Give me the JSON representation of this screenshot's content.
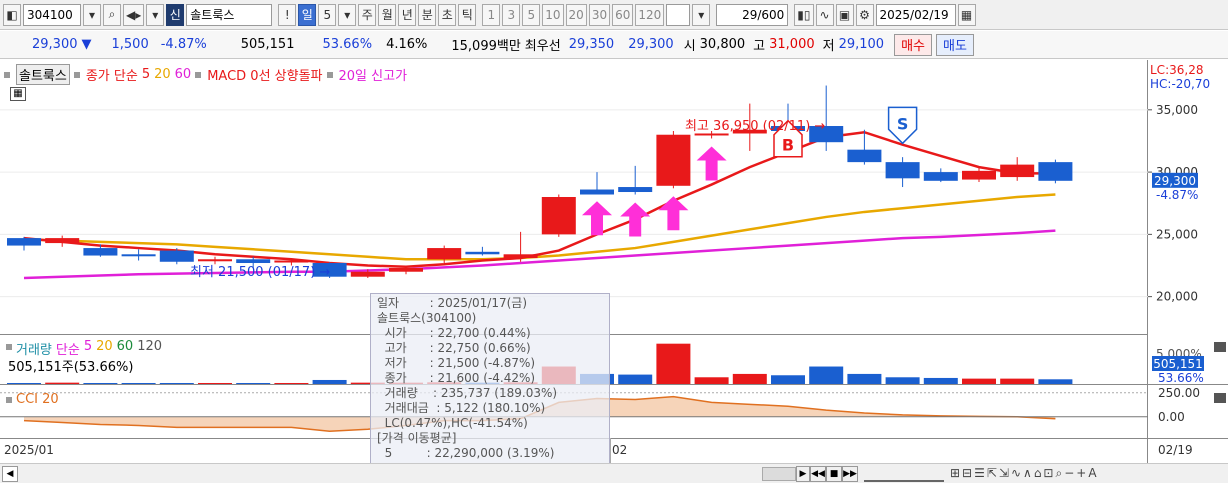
{
  "toolbar": {
    "code": "304100",
    "credit_badge": "신",
    "stock_name": "솔트룩스",
    "exclaim": "!",
    "period_day": "일",
    "period_num": "5",
    "tabs": [
      "주",
      "월",
      "년",
      "분",
      "초",
      "틱"
    ],
    "intervals": [
      "1",
      "3",
      "5",
      "10",
      "20",
      "30",
      "60",
      "120"
    ],
    "count": "29/600",
    "date": "2025/02/19"
  },
  "info": {
    "price": "29,300",
    "arrow": "▼",
    "change": "1,500",
    "change_pct": "-4.87%",
    "volume": "505,151",
    "vol_ratio": "53.66%",
    "turnover": "4.16%",
    "amount": "15,099백만",
    "best_label": "최우선",
    "ask": "29,350",
    "bid": "29,300",
    "open_label": "시",
    "open": "30,800",
    "high_label": "고",
    "high": "31,000",
    "low_label": "저",
    "low": "29,100",
    "buy_label": "매수",
    "sell_label": "매도"
  },
  "legend": {
    "name": "솔트룩스",
    "ma_label": "종가 단순",
    "ma5": "5",
    "ma20": "20",
    "ma60": "60",
    "macd": "MACD 0선 상향돌파",
    "newhigh": "20일 신고가"
  },
  "axis": {
    "lc": "LC:36,28",
    "hc": "HC:-20,70",
    "ticks": [
      "35,000",
      "30,000",
      "25,000",
      "20,000"
    ],
    "cur_price": "29,300",
    "cur_pct": "-4.87%",
    "vol_tick": "5,000%",
    "vol_val": "505,151",
    "vol_pct": "53.66%",
    "cci_ticks": [
      "250.00",
      "0.00"
    ],
    "date_start": "2025/01",
    "date_mid": "02",
    "date_end": "02/19"
  },
  "annotations": {
    "high": "최고 36,950 (02/11)",
    "low": "최저 21,500 (01/17)",
    "buy": "B",
    "sell": "S"
  },
  "volume_panel": {
    "title": "거래량",
    "ma_label": "단순",
    "ma5": "5",
    "ma20": "20",
    "ma60": "60",
    "ma120": "120",
    "summary": "505,151주(53.66%)"
  },
  "cci_panel": {
    "title": "CCI 20"
  },
  "tooltip": [
    "일자        : 2025/01/17(금)",
    "솔트룩스(304100)",
    "  시가      : 22,700 (0.44%)",
    "  고가      : 22,750 (0.66%)",
    "  저가      : 21,500 (-4.87%)",
    "  종가      : 21,600 (-4.42%)",
    "  거래량    : 235,737 (189.03%)",
    "  거래대금  : 5,122 (180.10%)",
    "  LC(0.47%),HC(-41.54%)",
    "[가격 이동평균]",
    "  5         : 22,290,000 (3.19%)"
  ],
  "colors": {
    "up": "#e8191a",
    "down": "#1a5fd0",
    "ma5": "#e8191a",
    "ma20": "#e8a800",
    "ma60": "#e020d8",
    "signal": "#ff2fd8"
  },
  "chart_data": {
    "type": "candlestick",
    "ylim": [
      17000,
      39000
    ],
    "candles": [
      {
        "o": 24700,
        "h": 24800,
        "l": 23700,
        "c": 24100
      },
      {
        "o": 24300,
        "h": 24900,
        "l": 24000,
        "c": 24700
      },
      {
        "o": 23900,
        "h": 24200,
        "l": 23200,
        "c": 23300
      },
      {
        "o": 23400,
        "h": 23800,
        "l": 22900,
        "c": 23300
      },
      {
        "o": 23700,
        "h": 23900,
        "l": 22600,
        "c": 22800
      },
      {
        "o": 22900,
        "h": 23200,
        "l": 22600,
        "c": 23000
      },
      {
        "o": 23000,
        "h": 23200,
        "l": 22300,
        "c": 22700
      },
      {
        "o": 22800,
        "h": 23000,
        "l": 22500,
        "c": 22900
      },
      {
        "o": 22700,
        "h": 22750,
        "l": 21500,
        "c": 21600
      },
      {
        "o": 21600,
        "h": 22200,
        "l": 21500,
        "c": 22000
      },
      {
        "o": 22000,
        "h": 22500,
        "l": 21800,
        "c": 22300
      },
      {
        "o": 23000,
        "h": 24100,
        "l": 22700,
        "c": 23900
      },
      {
        "o": 23600,
        "h": 24000,
        "l": 23300,
        "c": 23400
      },
      {
        "o": 23100,
        "h": 25200,
        "l": 22800,
        "c": 23400
      },
      {
        "o": 25000,
        "h": 28200,
        "l": 24800,
        "c": 28000
      },
      {
        "o": 28600,
        "h": 30000,
        "l": 28300,
        "c": 28200
      },
      {
        "o": 28800,
        "h": 30500,
        "l": 28200,
        "c": 28400
      },
      {
        "o": 28900,
        "h": 33300,
        "l": 28700,
        "c": 33000
      },
      {
        "o": 33000,
        "h": 33300,
        "l": 32700,
        "c": 33100
      },
      {
        "o": 33100,
        "h": 35500,
        "l": 31700,
        "c": 33400
      },
      {
        "o": 33700,
        "h": 35500,
        "l": 33000,
        "c": 33300
      },
      {
        "o": 33700,
        "h": 36950,
        "l": 31700,
        "c": 32400
      },
      {
        "o": 31800,
        "h": 33400,
        "l": 30600,
        "c": 30800
      },
      {
        "o": 30800,
        "h": 31200,
        "l": 28800,
        "c": 29500
      },
      {
        "o": 30000,
        "h": 30300,
        "l": 29200,
        "c": 29300
      },
      {
        "o": 29400,
        "h": 30400,
        "l": 29200,
        "c": 30100
      },
      {
        "o": 29600,
        "h": 31200,
        "l": 29300,
        "c": 30600
      },
      {
        "o": 30800,
        "h": 31000,
        "l": 29100,
        "c": 29300
      }
    ],
    "ma5": [
      24700,
      24400,
      24100,
      23900,
      23700,
      23400,
      23200,
      23000,
      22700,
      22500,
      22400,
      22600,
      22900,
      23100,
      23700,
      25000,
      26200,
      27700,
      29000,
      30400,
      31600,
      32800,
      33200,
      32200,
      31300,
      30400,
      29900,
      29900
    ],
    "ma20": [
      24600,
      24500,
      24400,
      24300,
      24200,
      24000,
      23800,
      23600,
      23400,
      23200,
      23000,
      23000,
      23000,
      23100,
      23300,
      23600,
      23900,
      24400,
      24900,
      25400,
      25900,
      26400,
      26800,
      27100,
      27400,
      27700,
      28000,
      28200
    ],
    "ma60": [
      21500,
      21600,
      21700,
      21800,
      21850,
      21900,
      21950,
      22000,
      22000,
      22100,
      22200,
      22350,
      22500,
      22700,
      22900,
      23100,
      23300,
      23500,
      23700,
      23900,
      24100,
      24300,
      24500,
      24700,
      24800,
      24950,
      25100,
      25300
    ],
    "volumes": [
      30,
      40,
      30,
      30,
      30,
      30,
      30,
      30,
      120,
      40,
      40,
      50,
      40,
      50,
      520,
      300,
      280,
      1200,
      200,
      300,
      260,
      520,
      300,
      200,
      180,
      160,
      160,
      140
    ],
    "cci": [
      -40,
      -60,
      -80,
      -90,
      -110,
      -110,
      -110,
      -110,
      -150,
      -130,
      -90,
      -40,
      -40,
      -20,
      150,
      190,
      180,
      210,
      150,
      130,
      110,
      70,
      40,
      20,
      10,
      5,
      0,
      -20
    ],
    "dates": [
      "2025/01",
      "02",
      "02/19"
    ]
  }
}
